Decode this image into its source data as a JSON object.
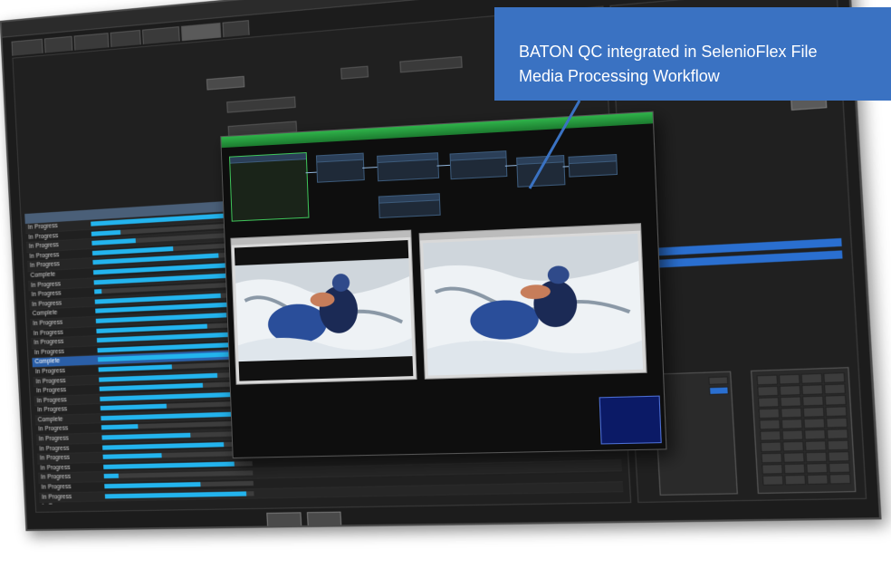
{
  "callout": {
    "line1": "BATON QC integrated in SelenioFlex File",
    "line2": "Media Processing Workflow"
  },
  "colors": {
    "callout_bg": "#3a72c2",
    "progress_bar": "#23b4ee",
    "selection": "#2a5fa8",
    "qc_titlebar": "#2fb34a"
  },
  "icons": [
    "window-icon",
    "workflow-node-icon",
    "video-frame-icon"
  ],
  "jobs": {
    "rows": [
      {
        "state": "In Progress",
        "progress": 0.93
      },
      {
        "state": "In Progress",
        "progress": 0.2
      },
      {
        "state": "In Progress",
        "progress": 0.3
      },
      {
        "state": "In Progress",
        "progress": 0.55
      },
      {
        "state": "In Progress",
        "progress": 0.85
      },
      {
        "state": "Complete",
        "progress": 1.0
      },
      {
        "state": "In Progress",
        "progress": 0.95
      },
      {
        "state": "In Progress",
        "progress": 0.05
      },
      {
        "state": "In Progress",
        "progress": 0.85
      },
      {
        "state": "Complete",
        "progress": 1.0
      },
      {
        "state": "In Progress",
        "progress": 0.88
      },
      {
        "state": "In Progress",
        "progress": 0.75
      },
      {
        "state": "In Progress",
        "progress": 0.9
      },
      {
        "state": "In Progress",
        "progress": 0.92
      },
      {
        "state": "Complete",
        "progress": 1.0
      },
      {
        "state": "In Progress",
        "progress": 0.5
      },
      {
        "state": "In Progress",
        "progress": 0.8
      },
      {
        "state": "In Progress",
        "progress": 0.7
      },
      {
        "state": "In Progress",
        "progress": 0.9
      },
      {
        "state": "In Progress",
        "progress": 0.45
      },
      {
        "state": "Complete",
        "progress": 1.0
      },
      {
        "state": "In Progress",
        "progress": 0.25
      },
      {
        "state": "In Progress",
        "progress": 0.6
      },
      {
        "state": "In Progress",
        "progress": 0.82
      },
      {
        "state": "In Progress",
        "progress": 0.4
      },
      {
        "state": "In Progress",
        "progress": 0.88
      },
      {
        "state": "In Progress",
        "progress": 0.1
      },
      {
        "state": "In Progress",
        "progress": 0.65
      },
      {
        "state": "In Progress",
        "progress": 0.95
      },
      {
        "state": "In Progress",
        "progress": 0.9
      },
      {
        "state": "In Progress",
        "progress": 0.3
      },
      {
        "state": "In Progress",
        "progress": 0.85
      },
      {
        "state": "In Progress",
        "progress": 0.5
      },
      {
        "state": "In Progress",
        "progress": 0.98
      }
    ]
  }
}
